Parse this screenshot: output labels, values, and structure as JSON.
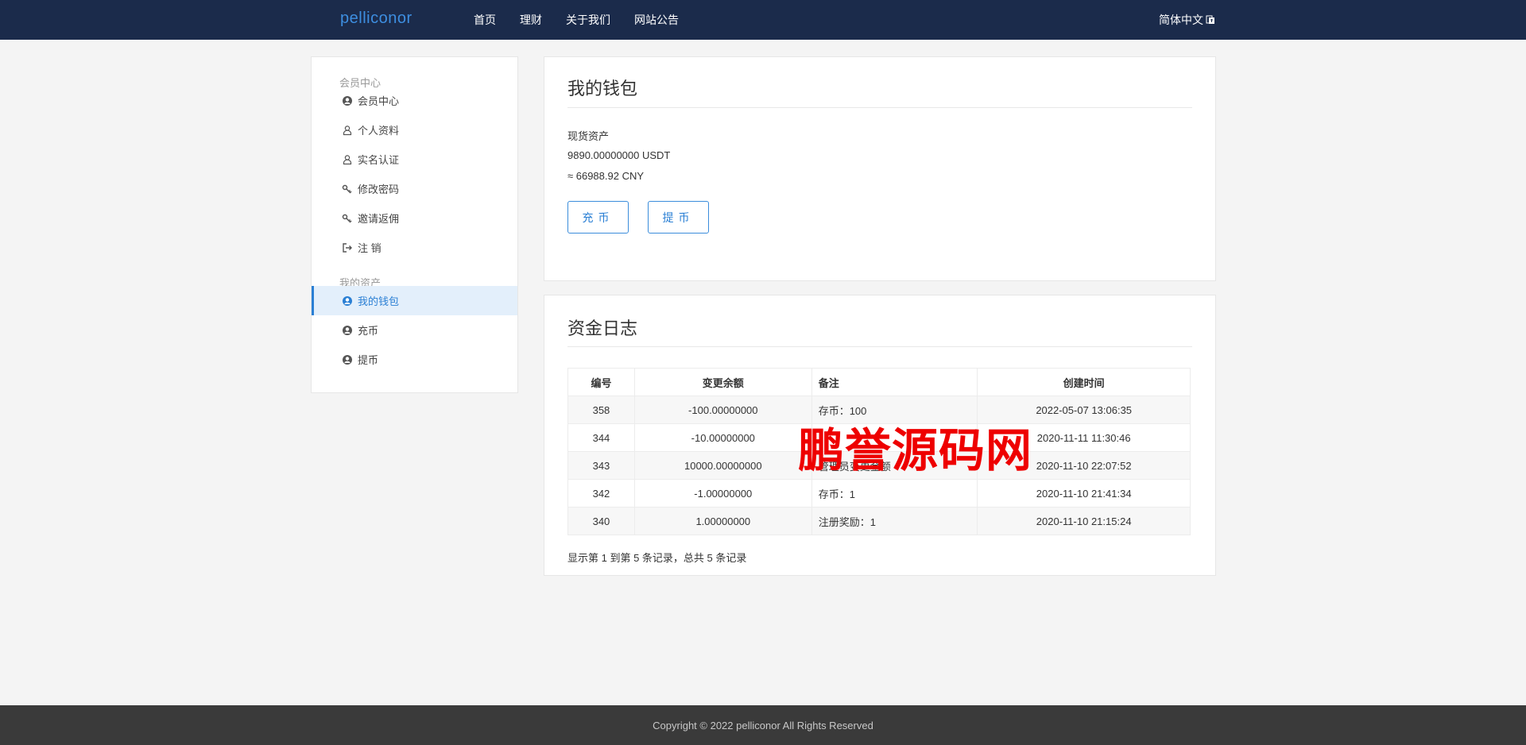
{
  "header": {
    "brand": "pelliconor",
    "nav": [
      "首页",
      "理财",
      "关于我们",
      "网站公告"
    ],
    "language": "简体中文"
  },
  "sidebar": {
    "group1": "会员中心",
    "items1": [
      {
        "label": "会员中心",
        "icon": "user-circle-icon"
      },
      {
        "label": "个人资料",
        "icon": "user-outline-icon"
      },
      {
        "label": "实名认证",
        "icon": "user-outline-icon"
      },
      {
        "label": "修改密码",
        "icon": "key-icon"
      },
      {
        "label": "邀请返佣",
        "icon": "key-icon"
      },
      {
        "label": "注 销",
        "icon": "sign-out-icon"
      }
    ],
    "group2": "我的资产",
    "items2": [
      {
        "label": "我的钱包",
        "icon": "user-circle-icon",
        "active": true
      },
      {
        "label": "充币",
        "icon": "user-circle-icon"
      },
      {
        "label": "提币",
        "icon": "user-circle-icon"
      }
    ]
  },
  "wallet": {
    "title": "我的钱包",
    "asset_label": "现货资产",
    "usdt": "9890.00000000 USDT",
    "cny": "≈ 66988.92 CNY",
    "deposit_label": "充币",
    "withdraw_label": "提币"
  },
  "log": {
    "title": "资金日志",
    "headers": [
      "编号",
      "变更余额",
      "备注",
      "创建时间"
    ],
    "rows": [
      [
        "358",
        "-100.00000000",
        "存币：100",
        "2022-05-07 13:06:35"
      ],
      [
        "344",
        "-10.00000000",
        "",
        "2020-11-11 11:30:46"
      ],
      [
        "343",
        "10000.00000000",
        "管理员变更金额",
        "2020-11-10 22:07:52"
      ],
      [
        "342",
        "-1.00000000",
        "存币：1",
        "2020-11-10 21:41:34"
      ],
      [
        "340",
        "1.00000000",
        "注册奖励：1",
        "2020-11-10 21:15:24"
      ]
    ],
    "pager": "显示第 1 到第 5 条记录，总共 5 条记录"
  },
  "watermark": "鹏誉源码网",
  "footer": "Copyright © 2022 pelliconor All Rights Reserved"
}
